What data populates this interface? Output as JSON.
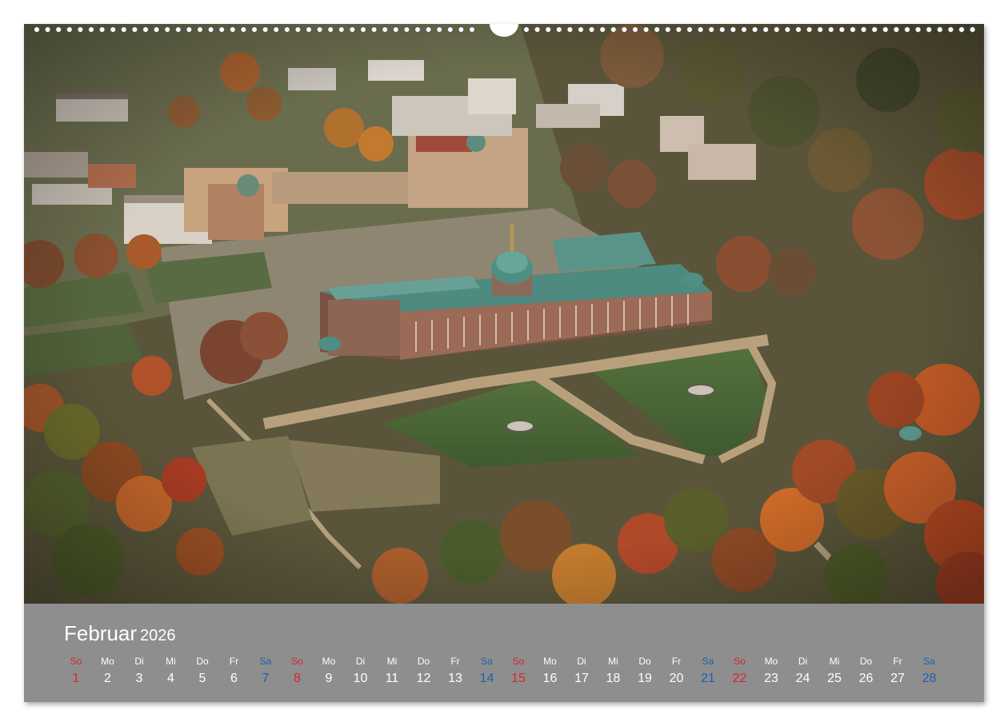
{
  "calendar": {
    "month": "Februar",
    "year": "2026",
    "colors": {
      "sunday": "#d8262b",
      "saturday": "#1d5fb0",
      "weekday": "#ffffff",
      "footer_bg": "#8e8e8e"
    },
    "days": [
      {
        "name": "So",
        "num": "1",
        "kind": "sun"
      },
      {
        "name": "Mo",
        "num": "2",
        "kind": "wd"
      },
      {
        "name": "Di",
        "num": "3",
        "kind": "wd"
      },
      {
        "name": "Mi",
        "num": "4",
        "kind": "wd"
      },
      {
        "name": "Do",
        "num": "5",
        "kind": "wd"
      },
      {
        "name": "Fr",
        "num": "6",
        "kind": "wd"
      },
      {
        "name": "Sa",
        "num": "7",
        "kind": "sat"
      },
      {
        "name": "So",
        "num": "8",
        "kind": "sun"
      },
      {
        "name": "Mo",
        "num": "9",
        "kind": "wd"
      },
      {
        "name": "Di",
        "num": "10",
        "kind": "wd"
      },
      {
        "name": "Mi",
        "num": "11",
        "kind": "wd"
      },
      {
        "name": "Do",
        "num": "12",
        "kind": "wd"
      },
      {
        "name": "Fr",
        "num": "13",
        "kind": "wd"
      },
      {
        "name": "Sa",
        "num": "14",
        "kind": "sat"
      },
      {
        "name": "So",
        "num": "15",
        "kind": "sun"
      },
      {
        "name": "Mo",
        "num": "16",
        "kind": "wd"
      },
      {
        "name": "Di",
        "num": "17",
        "kind": "wd"
      },
      {
        "name": "Mi",
        "num": "18",
        "kind": "wd"
      },
      {
        "name": "Do",
        "num": "19",
        "kind": "wd"
      },
      {
        "name": "Fr",
        "num": "20",
        "kind": "wd"
      },
      {
        "name": "Sa",
        "num": "21",
        "kind": "sat"
      },
      {
        "name": "So",
        "num": "22",
        "kind": "sun"
      },
      {
        "name": "Mo",
        "num": "23",
        "kind": "wd"
      },
      {
        "name": "Di",
        "num": "24",
        "kind": "wd"
      },
      {
        "name": "Mi",
        "num": "25",
        "kind": "wd"
      },
      {
        "name": "Do",
        "num": "26",
        "kind": "wd"
      },
      {
        "name": "Fr",
        "num": "27",
        "kind": "wd"
      },
      {
        "name": "Sa",
        "num": "28",
        "kind": "sat"
      }
    ]
  },
  "photo": {
    "subject": "aerial-palace-park-autumn",
    "colors": {
      "lawn": "#4f6a38",
      "path": "#b49a78",
      "roof": "#4e8a80",
      "facade": "#8a6a58",
      "foliage_orange": "#b35a22",
      "foliage_green": "#4c5a2e"
    }
  },
  "binding": {
    "icon": "spiral-binding-icon"
  }
}
